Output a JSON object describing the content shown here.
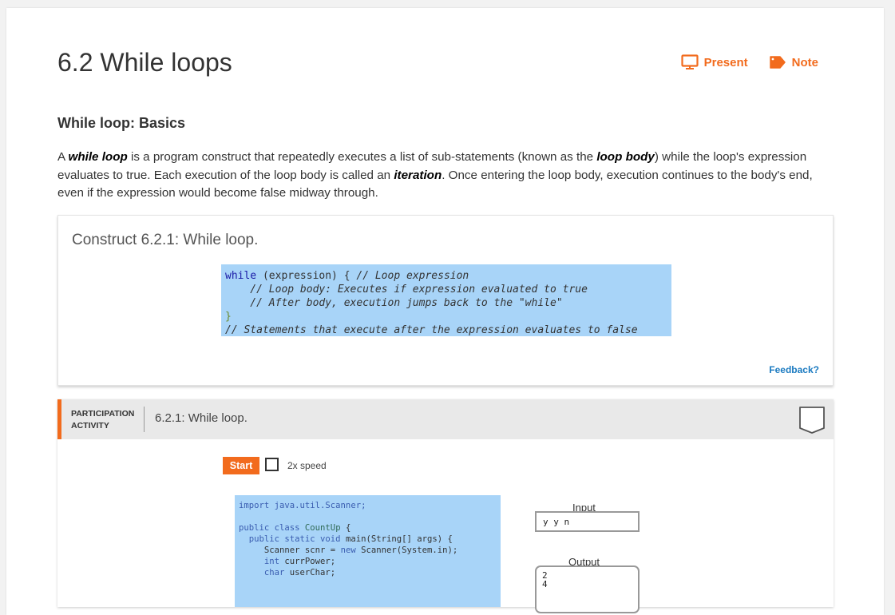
{
  "section": {
    "title": "6.2 While loops",
    "actions": [
      {
        "label": "Present",
        "icon": "monitor-icon"
      },
      {
        "label": "Note",
        "icon": "note-tag-icon"
      }
    ]
  },
  "subsection": {
    "heading": "While loop: Basics",
    "paragraph": {
      "t1": "A ",
      "b1": "while loop",
      "t2": " is a program construct that repeatedly executes a list of sub-statements (known as the ",
      "b2": "loop body",
      "t3": ") while the loop's expression evaluates to true. Each execution of the loop body is called an ",
      "b3": "iteration",
      "t4": ". Once entering the loop body, execution continues to the body's end, even if the expression would become false midway through."
    }
  },
  "construct": {
    "title": "Construct 6.2.1: While loop.",
    "code": {
      "l1_kw": "while",
      "l1_rest": " (expression) { ",
      "l1_cm": "// Loop expression",
      "l2": "    // Loop body: Executes if expression evaluated to true",
      "l3": "    // After body, execution jumps back to the \"while\"",
      "l4": "}",
      "l5": "// Statements that execute after the expression evaluates to false"
    },
    "feedback": "Feedback?"
  },
  "activity": {
    "label_line1": "PARTICIPATION",
    "label_line2": "ACTIVITY",
    "title": "6.2.1: While loop.",
    "start": "Start",
    "speed": "2x speed",
    "code": {
      "l1": "import java.util.Scanner;",
      "l2a": "public class ",
      "l2b": "CountUp",
      "l2c": " {",
      "l3a": "  public static void ",
      "l3b": "main(String[] args) {",
      "l4a": "     Scanner scnr = ",
      "l4b": "new ",
      "l4c": "Scanner(System.in);",
      "l5a": "     int ",
      "l5b": "currPower;",
      "l6a": "     char ",
      "l6b": "userChar;"
    },
    "input_label": "Input",
    "input_value": "y y n",
    "output_label": "Output",
    "output_value": "2\n4"
  },
  "colors": {
    "accent": "#f26b1d",
    "code_bg": "#a8d4f8",
    "link": "#1a7ac0"
  }
}
